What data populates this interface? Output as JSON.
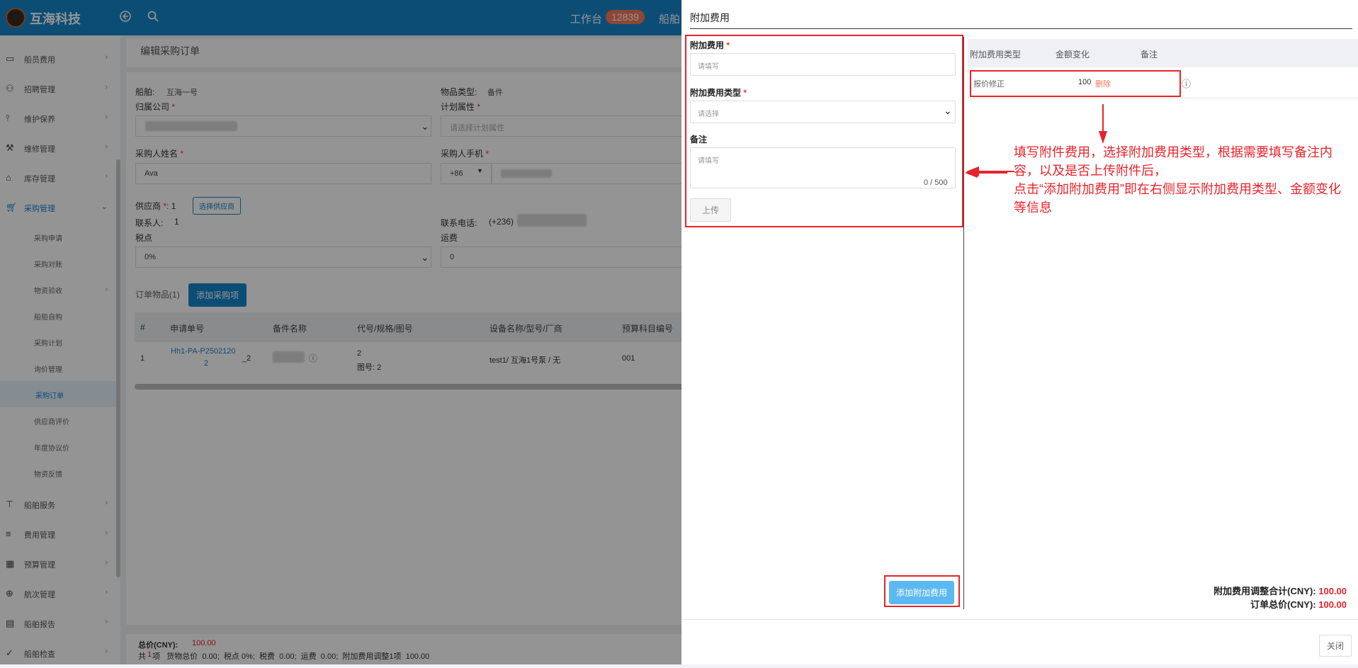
{
  "app": {
    "name": "互海科技",
    "workbench": "工作台",
    "workbench_count": "12839",
    "top_ship": "船舶"
  },
  "sidebar": {
    "items": [
      {
        "label": "船员费用",
        "icon": "card-icon"
      },
      {
        "label": "招聘管理",
        "icon": "user-icon"
      },
      {
        "label": "维护保养",
        "icon": "tool-icon"
      },
      {
        "label": "维修管理",
        "icon": "wrench-icon"
      },
      {
        "label": "库存管理",
        "icon": "home-icon"
      },
      {
        "label": "采购管理",
        "icon": "cart-icon"
      }
    ],
    "sub_items": [
      "采购申请",
      "采购对账",
      "物资验收",
      "船舶自购",
      "采购计划",
      "询价管理",
      "采购订单",
      "供应商评价",
      "年度协议价",
      "物资反馈"
    ],
    "bottom_items": [
      {
        "label": "船舶服务",
        "icon": "roller-icon"
      },
      {
        "label": "费用管理",
        "icon": "database-icon"
      },
      {
        "label": "预算管理",
        "icon": "calculator-icon"
      },
      {
        "label": "航次管理",
        "icon": "globe-icon"
      },
      {
        "label": "船舶报告",
        "icon": "grid-icon"
      },
      {
        "label": "船舶检查",
        "icon": "check-circle-icon"
      }
    ]
  },
  "order": {
    "page_title": "编辑采购订单",
    "ship_label": "船舶:",
    "ship_value": "互海一号",
    "item_type_label": "物品类型:",
    "item_type_value": "备件",
    "company_label": "归属公司",
    "plan_attr_label": "计划属性",
    "plan_attr_placeholder": "请选择计划属性",
    "buyer_name_label": "采购人姓名",
    "buyer_name_value": "Ava",
    "buyer_phone_label": "采购人手机",
    "phone_prefix": "+86",
    "supplier_label": "供应商",
    "supplier_count": "1",
    "select_supplier_btn": "选择供应商",
    "contact_label": "联系人:",
    "contact_value": "1",
    "contact_phone_label": "联系电话:",
    "contact_phone_value": "(+236)",
    "tax_label": "税点",
    "tax_value": "0%",
    "freight_label": "运费",
    "freight_value": "0",
    "items_label": "订单物品(1)",
    "add_item_btn": "添加采购项",
    "table": {
      "headers": [
        "#",
        "申请单号",
        "备件名称",
        "代号/规格/图号",
        "设备名称/型号/厂商",
        "预算科目编号"
      ],
      "row": {
        "index": "1",
        "req_no_a": "Hh1-PA-P2502120",
        "req_no_b": "2",
        "req_no_suffix": "_2",
        "spec": "2",
        "drawing": "图号:  2",
        "equipment": "test1/ 互海1号泵 / 无",
        "budget": "001"
      }
    },
    "footer": {
      "total_label": "总价(CNY):",
      "total_value": "100.00",
      "summary_a": "共",
      "summary_count": "1",
      "summary_b": "项   货物总价  0.00;  税点 0%;  税费  0.00;  运费  0.00;  附加费用调整1项  100.00"
    }
  },
  "drawer": {
    "title": "附加费用",
    "fee_label": "附加费用",
    "fee_placeholder": "请填写",
    "fee_type_label": "附加费用类型",
    "fee_type_placeholder": "请选择",
    "remark_label": "备注",
    "remark_placeholder": "请填写",
    "remark_count": "0 / 500",
    "upload_btn": "上传",
    "add_fee_btn": "添加附加费用",
    "table_headers": [
      "附加费用类型",
      "金额变化",
      "备注"
    ],
    "row": {
      "type": "报价修正",
      "amount": "100",
      "delete": "删除"
    },
    "annotation_1": "填写附件费用，选择附加费用类型，根据需要填写备注内容，以及是否上传附件后，",
    "annotation_2": "点击“添加附加费用”即在右侧显示附加费用类型、金额变化等信息",
    "adj_total_label": "附加费用调整合计(CNY):",
    "adj_total_value": "100.00",
    "order_total_label": "订单总价(CNY):",
    "order_total_value": "100.00",
    "close_btn": "关闭"
  },
  "colors": {
    "primary": "#1585cc",
    "annotation_red": "#e8232b",
    "badge": "#f37b5a"
  }
}
